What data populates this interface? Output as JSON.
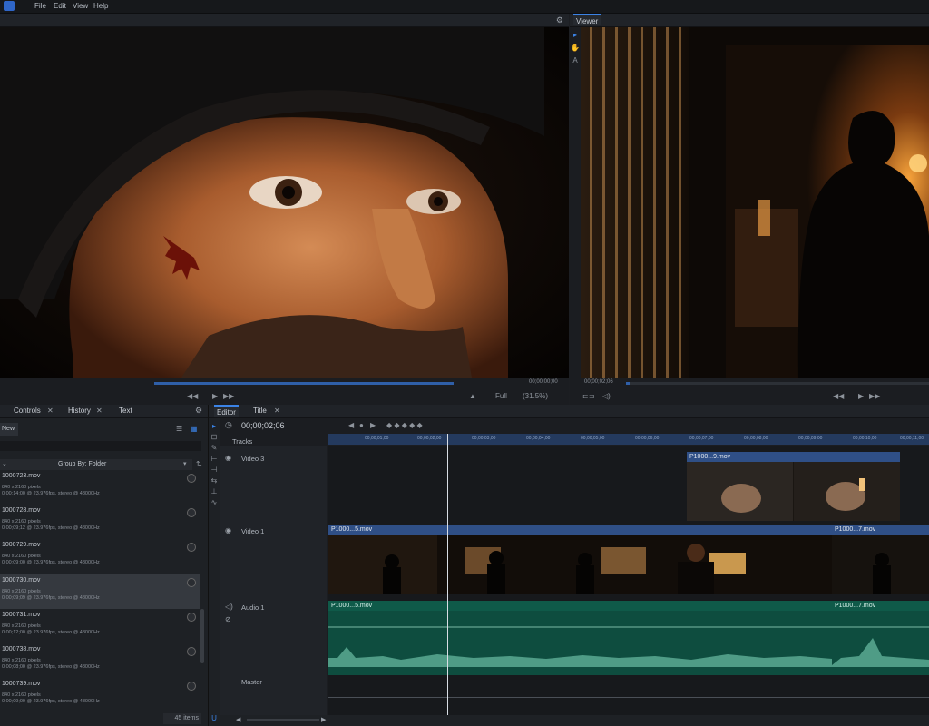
{
  "menubar": {
    "items": [
      "File",
      "Edit",
      "View",
      "Help"
    ]
  },
  "viewer": {
    "tab": "Viewer",
    "timecode": "00;00;02;06",
    "zoom_label": "Full",
    "zoom_pct": "(31.5%)"
  },
  "trimmer": {
    "timecode": "00;00;00;00"
  },
  "media_panel": {
    "tabs": [
      "Controls",
      "History",
      "Text"
    ],
    "new_button": "New",
    "group_by": "Group By: Folder",
    "items": [
      {
        "name": "1000723.mov",
        "meta": "840 x 2160 pixels\n0;00;14;00 @ 23.976fps, stereo @ 48000Hz"
      },
      {
        "name": "1000728.mov",
        "meta": "840 x 2160 pixels\n0;00;09;12 @ 23.976fps, stereo @ 48000Hz"
      },
      {
        "name": "1000729.mov",
        "meta": "840 x 2160 pixels\n0;00;09;00 @ 23.976fps, stereo @ 48000Hz"
      },
      {
        "name": "1000730.mov",
        "meta": "840 x 2160 pixels\n0;00;09;09 @ 23.976fps, stereo @ 48000Hz"
      },
      {
        "name": "1000731.mov",
        "meta": "840 x 2160 pixels\n0;00;12;00 @ 23.976fps, stereo @ 48000Hz"
      },
      {
        "name": "1000738.mov",
        "meta": "840 x 2160 pixels\n0;00;08;00 @ 23.976fps, stereo @ 48000Hz"
      },
      {
        "name": "1000739.mov",
        "meta": "840 x 2160 pixels\n0;00;09;00 @ 23.976fps, stereo @ 48000Hz"
      }
    ],
    "count": "45 items"
  },
  "editor": {
    "tabs": [
      "Editor",
      "Title"
    ],
    "timecode": "00;00;02;06",
    "tracks_label": "Tracks",
    "tracks": [
      "Video 3",
      "Video 1",
      "Audio 1",
      "Master"
    ],
    "ruler_ticks": [
      "00;00;01;00",
      "00;00;02;00",
      "00;00;03;00",
      "00;00;04;00",
      "00;00;05;00",
      "00;00;06;00",
      "00;00;07;00",
      "00;00;08;00",
      "00;00;09;00",
      "00;00;10;00",
      "00;00;11;00"
    ],
    "clips": {
      "v3": "P1000...9.mov",
      "v1a": "P1000...5.mov",
      "v1b": "P1000...7.mov",
      "a1a": "P1000...5.mov",
      "a1b": "P1000...7.mov"
    }
  },
  "colors": {
    "accent": "#3b83e6",
    "video_clip": "#2f4f86",
    "audio_clip": "#0f5a49"
  }
}
